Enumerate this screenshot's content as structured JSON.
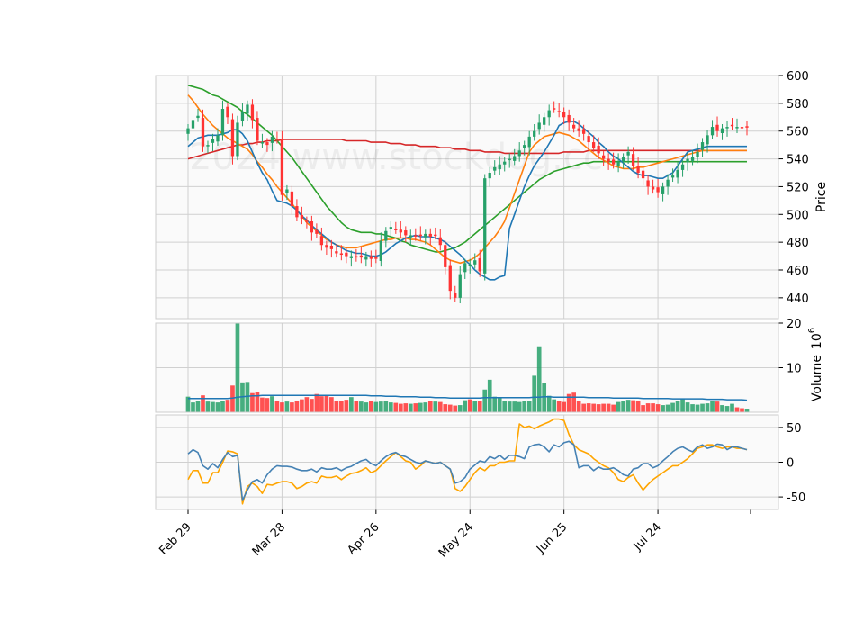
{
  "chart_data": {
    "type": "candlestick",
    "watermark": "2024 www.stockdog.cc",
    "x_tick_labels": [
      "Feb 29",
      "Mar 28",
      "Apr 26",
      "May 24",
      "Jun 25",
      "Jul 24"
    ],
    "x_tick_indices": [
      0,
      19,
      38,
      57,
      76,
      95
    ],
    "num_bars": 114,
    "colors": {
      "up": "#26a069",
      "down": "#ff3333",
      "ma_short": "#1f77b4",
      "ma_mid": "#ff7f0e",
      "ma_long": "#2ca02c",
      "ma_longest": "#d62728",
      "vol_ma": "#1f77b4",
      "osc_fast": "#4682b4",
      "osc_slow": "#ffa500",
      "grid": "#d0d0d0",
      "panel_bg": "#fafafa"
    },
    "price_panel": {
      "ylabel": "Price",
      "ylim": [
        425,
        600
      ],
      "yticks": [
        440,
        460,
        480,
        500,
        520,
        540,
        560,
        580,
        600
      ],
      "close": [
        562,
        568,
        571,
        549,
        550,
        554,
        557,
        576,
        570,
        542,
        566,
        574,
        579,
        568,
        553,
        552,
        550,
        556,
        554,
        514,
        518,
        506,
        498,
        497,
        495,
        487,
        486,
        478,
        476,
        475,
        472,
        471,
        470,
        470,
        469,
        469,
        470,
        468,
        468,
        481,
        488,
        491,
        489,
        487,
        485,
        485,
        484,
        485,
        486,
        484,
        485,
        478,
        462,
        445,
        440,
        457,
        465,
        464,
        467,
        459,
        526,
        530,
        534,
        536,
        538,
        540,
        542,
        546,
        550,
        556,
        560,
        566,
        570,
        575,
        576,
        574,
        570,
        566,
        562,
        560,
        558,
        552,
        548,
        544,
        540,
        538,
        536,
        538,
        541,
        545,
        535,
        530,
        526,
        520,
        518,
        516,
        520,
        525,
        528,
        532,
        536,
        540,
        541,
        545,
        552,
        557,
        563,
        560,
        562,
        563,
        564,
        563,
        562,
        563
      ],
      "volume": [
        3.5,
        2.2,
        2.6,
        3.8,
        2.4,
        2.3,
        2.2,
        2.5,
        2.8,
        6,
        20,
        6.7,
        6.8,
        4.3,
        4.5,
        3.3,
        3.2,
        3.6,
        2.5,
        2.2,
        2.4,
        2.2,
        2.6,
        2.9,
        3.4,
        3,
        4.1,
        3.6,
        3.9,
        3.4,
        2.6,
        2.5,
        2.8,
        3.4,
        2.5,
        2.4,
        2.2,
        2.5,
        2.3,
        2.4,
        2.6,
        2.2,
        2.1,
        1.9,
        2,
        1.9,
        2,
        2.1,
        2.2,
        2.5,
        2.4,
        2.3,
        1.8,
        1.7,
        1.5,
        1.6,
        2.7,
        2.9,
        2.6,
        2.5,
        5.1,
        7.3,
        3.5,
        3.2,
        2.6,
        2.4,
        2.4,
        2.3,
        2.5,
        2.6,
        8.2,
        14.8,
        6.6,
        3.7,
        2.9,
        2.5,
        2.3,
        4.1,
        4.4,
        2.6,
        1.9,
        2,
        1.9,
        1.8,
        1.9,
        1.9,
        1.7,
        2.3,
        2.5,
        2.8,
        2.7,
        2.5,
        1.6,
        2,
        2,
        1.8,
        1.6,
        1.7,
        2.1,
        2.5,
        3,
        2.2,
        1.8,
        1.7,
        1.9,
        2,
        2.6,
        2.4,
        1.6,
        1.4,
        1.9,
        1.1,
        0.9,
        0.8
      ],
      "ma_short": [
        549,
        552,
        555,
        556,
        557,
        557,
        557,
        558,
        559,
        561,
        561,
        558,
        553,
        545,
        537,
        530,
        525,
        517,
        510,
        509,
        508,
        506,
        503,
        499,
        496,
        492,
        489,
        486,
        483,
        480,
        478,
        476,
        474,
        473,
        472,
        472,
        471,
        470,
        470,
        471,
        473,
        476,
        479,
        481,
        483,
        484,
        485,
        484,
        484,
        484,
        483,
        482,
        480,
        477,
        474,
        471,
        467,
        464,
        460,
        457,
        455,
        453,
        453,
        455,
        456,
        490,
        500,
        510,
        520,
        528,
        535,
        540,
        545,
        551,
        557,
        564,
        566,
        567,
        567,
        565,
        562,
        559,
        556,
        552,
        549,
        545,
        542,
        540,
        537,
        534,
        531,
        529,
        528,
        528,
        527,
        526,
        526,
        528,
        530,
        535,
        540,
        545,
        546,
        547,
        548,
        549,
        549,
        549,
        549,
        549,
        549,
        549,
        549,
        549
      ],
      "ma_mid": [
        586,
        582,
        577,
        572,
        568,
        564,
        561,
        558,
        555,
        553,
        551,
        549,
        547,
        543,
        538,
        534,
        529,
        525,
        520,
        516,
        512,
        508,
        503,
        499,
        494,
        491,
        488,
        485,
        482,
        480,
        478,
        477,
        476,
        476,
        476,
        477,
        478,
        479,
        480,
        481,
        482,
        482,
        483,
        483,
        483,
        482,
        482,
        481,
        480,
        478,
        475,
        472,
        469,
        467,
        466,
        465,
        466,
        467,
        469,
        472,
        476,
        480,
        484,
        489,
        495,
        505,
        515,
        525,
        535,
        545,
        550,
        553,
        556,
        557,
        558,
        559,
        558,
        557,
        555,
        553,
        550,
        547,
        544,
        541,
        539,
        537,
        535,
        534,
        533,
        533,
        533,
        534,
        534,
        535,
        536,
        537,
        538,
        539,
        540,
        541,
        542,
        543,
        544,
        545,
        546,
        546,
        546,
        546,
        546,
        546,
        546,
        546,
        546,
        546
      ],
      "ma_long": [
        593,
        592,
        591,
        590,
        588,
        586,
        585,
        583,
        581,
        579,
        577,
        574,
        572,
        569,
        566,
        563,
        560,
        557,
        553,
        549,
        545,
        541,
        536,
        531,
        526,
        521,
        516,
        511,
        506,
        502,
        498,
        494,
        491,
        489,
        488,
        487,
        487,
        487,
        486,
        486,
        485,
        484,
        483,
        481,
        480,
        478,
        477,
        476,
        475,
        474,
        473,
        473,
        474,
        475,
        476,
        478,
        480,
        483,
        486,
        489,
        492,
        495,
        498,
        501,
        504,
        507,
        510,
        513,
        516,
        519,
        522,
        525,
        527,
        529,
        531,
        532,
        533,
        534,
        535,
        536,
        537,
        537,
        538,
        538,
        538,
        538,
        538,
        538,
        538,
        538,
        538,
        538,
        538,
        538,
        538,
        538,
        538,
        538,
        538,
        538,
        538,
        538,
        538,
        538,
        538,
        538,
        538,
        538,
        538,
        538,
        538,
        538,
        538,
        538
      ],
      "ma_longest": [
        540,
        541,
        542,
        543,
        544,
        545,
        546,
        547,
        548,
        549,
        550,
        550,
        551,
        551,
        552,
        552,
        553,
        553,
        553,
        554,
        554,
        554,
        554,
        554,
        554,
        554,
        554,
        554,
        554,
        554,
        554,
        554,
        553,
        553,
        553,
        553,
        553,
        552,
        552,
        552,
        552,
        551,
        551,
        551,
        550,
        550,
        550,
        549,
        549,
        549,
        549,
        548,
        548,
        548,
        547,
        547,
        547,
        546,
        546,
        546,
        545,
        545,
        545,
        545,
        544,
        544,
        544,
        544,
        544,
        544,
        544,
        544,
        544,
        544,
        544,
        544,
        545,
        545,
        545,
        545,
        545,
        546,
        546,
        546,
        546,
        546,
        546,
        546,
        546,
        546,
        546,
        546,
        546,
        546,
        546,
        546,
        546,
        546,
        546,
        546,
        546,
        546,
        546,
        546,
        546,
        546,
        546,
        546,
        546,
        546,
        546,
        546,
        546,
        546
      ],
      "vol_ma": [
        3.1,
        3.1,
        3.1,
        3.1,
        3.1,
        3.1,
        3.1,
        3.1,
        3.1,
        3.2,
        3.4,
        3.5,
        3.6,
        3.7,
        3.7,
        3.8,
        3.8,
        3.8,
        3.8,
        3.8,
        3.8,
        3.8,
        3.8,
        3.8,
        3.8,
        3.8,
        3.8,
        3.8,
        3.8,
        3.8,
        3.8,
        3.8,
        3.8,
        3.8,
        3.8,
        3.8,
        3.8,
        3.7,
        3.7,
        3.7,
        3.6,
        3.6,
        3.6,
        3.5,
        3.5,
        3.5,
        3.5,
        3.4,
        3.4,
        3.4,
        3.3,
        3.3,
        3.3,
        3.2,
        3.2,
        3.2,
        3.2,
        3.2,
        3.2,
        3.2,
        3.3,
        3.3,
        3.3,
        3.3,
        3.3,
        3.3,
        3.3,
        3.3,
        3.3,
        3.3,
        3.4,
        3.4,
        3.5,
        3.5,
        3.4,
        3.4,
        3.4,
        3.4,
        3.4,
        3.4,
        3.4,
        3.3,
        3.3,
        3.3,
        3.3,
        3.3,
        3.2,
        3.2,
        3.2,
        3.2,
        3.2,
        3.2,
        3.1,
        3.1,
        3.1,
        3.1,
        3.1,
        3.1,
        3.0,
        3.0,
        3.0,
        3.0,
        3.0,
        3.0,
        3.0,
        2.9,
        2.9,
        2.9,
        2.9,
        2.8,
        2.8,
        2.8,
        2.8,
        2.7
      ]
    },
    "volume_panel": {
      "ylabel": "Volume  10^6",
      "ylabel_main": "Volume",
      "ylabel_exp": "6",
      "ylabel_base": "10",
      "ylim": [
        0,
        20
      ],
      "yticks": [
        10,
        20
      ]
    },
    "oscillator_panel": {
      "ylim": [
        -68,
        68
      ],
      "yticks": [
        -50,
        0,
        50
      ],
      "fast": [
        12,
        18,
        14,
        -5,
        -10,
        -2,
        -8,
        4,
        14,
        8,
        10,
        -55,
        -40,
        -28,
        -25,
        -30,
        -18,
        -10,
        -5,
        -6,
        -6,
        -7,
        -10,
        -12,
        -12,
        -10,
        -14,
        -8,
        -10,
        -10,
        -8,
        -12,
        -8,
        -6,
        -2,
        2,
        4,
        -2,
        -5,
        2,
        8,
        12,
        14,
        10,
        8,
        4,
        0,
        -2,
        2,
        0,
        -2,
        0,
        -5,
        -10,
        -30,
        -28,
        -22,
        -10,
        -4,
        2,
        0,
        8,
        5,
        10,
        4,
        10,
        10,
        8,
        5,
        22,
        25,
        26,
        22,
        15,
        25,
        22,
        28,
        30,
        25,
        -8,
        -5,
        -5,
        -12,
        -7,
        -10,
        -10,
        -8,
        -12,
        -18,
        -20,
        -10,
        -8,
        -2,
        -2,
        -8,
        -5,
        2,
        8,
        15,
        20,
        22,
        18,
        15,
        22,
        25,
        20,
        22,
        26,
        25,
        18,
        22,
        22,
        20,
        18
      ],
      "slow": [
        -25,
        -12,
        -12,
        -30,
        -30,
        -15,
        -15,
        0,
        16,
        15,
        12,
        -60,
        -35,
        -30,
        -35,
        -45,
        -32,
        -33,
        -30,
        -28,
        -28,
        -30,
        -38,
        -35,
        -30,
        -28,
        -30,
        -20,
        -22,
        -22,
        -20,
        -25,
        -20,
        -16,
        -15,
        -12,
        -8,
        -15,
        -12,
        -5,
        2,
        8,
        14,
        8,
        2,
        0,
        -10,
        -5,
        2,
        0,
        -2,
        0,
        -5,
        -10,
        -38,
        -42,
        -35,
        -25,
        -15,
        -8,
        -12,
        -5,
        -5,
        0,
        0,
        2,
        2,
        55,
        50,
        52,
        48,
        52,
        55,
        58,
        62,
        62,
        60,
        40,
        25,
        18,
        15,
        12,
        5,
        0,
        -5,
        -8,
        -15,
        -25,
        -28,
        -22,
        -18,
        -30,
        -40,
        -32,
        -25,
        -20,
        -15,
        -10,
        -5,
        -5,
        0,
        5,
        12,
        20,
        22,
        25,
        25,
        22,
        20,
        22,
        22,
        20,
        20,
        18
      ]
    }
  }
}
